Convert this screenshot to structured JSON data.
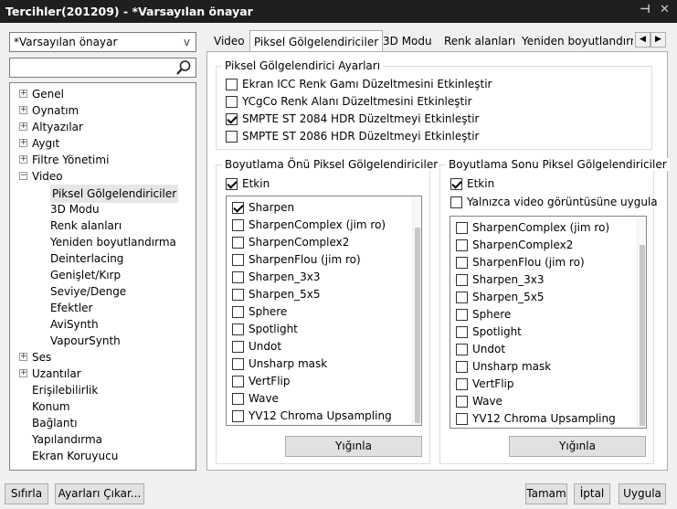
{
  "window": {
    "title": "Tercihler(201209) - *Varsayılan önayar",
    "pin_glyph": "⊣",
    "close_glyph": "✕"
  },
  "preset": {
    "value": "*Varsayılan önayar",
    "chevron": "v"
  },
  "search": {
    "value": ""
  },
  "tree": {
    "items": [
      {
        "label": "Genel",
        "exp": "+"
      },
      {
        "label": "Oynatım",
        "exp": "+"
      },
      {
        "label": "Altyazılar",
        "exp": "+"
      },
      {
        "label": "Aygıt",
        "exp": "+"
      },
      {
        "label": "Filtre Yönetimi",
        "exp": "+"
      },
      {
        "label": "Video",
        "exp": "−"
      },
      {
        "label": "Piksel Gölgelendiriciler",
        "exp": ""
      },
      {
        "label": "3D Modu",
        "exp": ""
      },
      {
        "label": "Renk alanları",
        "exp": ""
      },
      {
        "label": "Yeniden boyutlandırma",
        "exp": ""
      },
      {
        "label": "Deinterlacing",
        "exp": ""
      },
      {
        "label": "Genişlet/Kırp",
        "exp": ""
      },
      {
        "label": "Seviye/Denge",
        "exp": ""
      },
      {
        "label": "Efektler",
        "exp": ""
      },
      {
        "label": "AviSynth",
        "exp": ""
      },
      {
        "label": "VapourSynth",
        "exp": ""
      },
      {
        "label": "Ses",
        "exp": "+"
      },
      {
        "label": "Uzantılar",
        "exp": "+"
      },
      {
        "label": "Erişilebilirlik",
        "exp": ""
      },
      {
        "label": "Konum",
        "exp": ""
      },
      {
        "label": "Bağlantı",
        "exp": ""
      },
      {
        "label": "Yapılandırma",
        "exp": ""
      },
      {
        "label": "Ekran Koruyucu",
        "exp": ""
      }
    ]
  },
  "tabs": [
    "Video",
    "Piksel Gölgelendiriciler",
    "3D Modu",
    "Renk alanları",
    "Yeniden boyutlandırma"
  ],
  "tab_scroll": {
    "left": "◀",
    "right": "▶"
  },
  "settings_group": {
    "legend": "Piksel Gölgelendirici Ayarları",
    "options": [
      {
        "label": "Ekran ICC Renk Gamı Düzeltmesini Etkinleştir",
        "checked": false
      },
      {
        "label": "YCgCo Renk Alanı Düzeltmesini Etkinleştir",
        "checked": false
      },
      {
        "label": "SMPTE ST 2084 HDR Düzeltmeyi Etkinleştir",
        "checked": true
      },
      {
        "label": "SMPTE ST 2086 HDR Düzeltmeyi Etkinleştir",
        "checked": false
      }
    ]
  },
  "pre_group": {
    "legend": "Boyutlama Önü Piksel Gölgelendiriciler",
    "enabled_label": "Etkin",
    "enabled": true,
    "shaders": [
      {
        "label": "Sharpen",
        "checked": true
      },
      {
        "label": "SharpenComplex (jim ro)",
        "checked": false
      },
      {
        "label": "SharpenComplex2",
        "checked": false
      },
      {
        "label": "SharpenFlou (jim ro)",
        "checked": false
      },
      {
        "label": "Sharpen_3x3",
        "checked": false
      },
      {
        "label": "Sharpen_5x5",
        "checked": false
      },
      {
        "label": "Sphere",
        "checked": false
      },
      {
        "label": "Spotlight",
        "checked": false
      },
      {
        "label": "Undot",
        "checked": false
      },
      {
        "label": "Unsharp mask",
        "checked": false
      },
      {
        "label": "VertFlip",
        "checked": false
      },
      {
        "label": "Wave",
        "checked": false
      },
      {
        "label": "YV12 Chroma Upsampling",
        "checked": false
      }
    ],
    "scroll_fraction": 0.85,
    "stack_button": "Yığınla"
  },
  "post_group": {
    "legend": "Boyutlama Sonu Piksel Gölgelendiriciler",
    "enabled_label": "Etkin",
    "enabled": true,
    "video_only_label": "Yalnızca video görüntüsüne uygula",
    "video_only": false,
    "shaders": [
      {
        "label": "SharpenComplex (jim ro)",
        "checked": false
      },
      {
        "label": "SharpenComplex2",
        "checked": false
      },
      {
        "label": "SharpenFlou (jim ro)",
        "checked": false
      },
      {
        "label": "Sharpen_3x3",
        "checked": false
      },
      {
        "label": "Sharpen_5x5",
        "checked": false
      },
      {
        "label": "Sphere",
        "checked": false
      },
      {
        "label": "Spotlight",
        "checked": false
      },
      {
        "label": "Undot",
        "checked": false
      },
      {
        "label": "Unsharp mask",
        "checked": false
      },
      {
        "label": "VertFlip",
        "checked": false
      },
      {
        "label": "Wave",
        "checked": false
      },
      {
        "label": "YV12 Chroma Upsampling",
        "checked": false
      }
    ],
    "scroll_fraction": 0.85,
    "stack_button": "Yığınla"
  },
  "footer": {
    "reset": "Sıfırla",
    "export": "Ayarları Çıkar...",
    "ok": "Tamam",
    "cancel": "İptal",
    "apply": "Uygula"
  }
}
